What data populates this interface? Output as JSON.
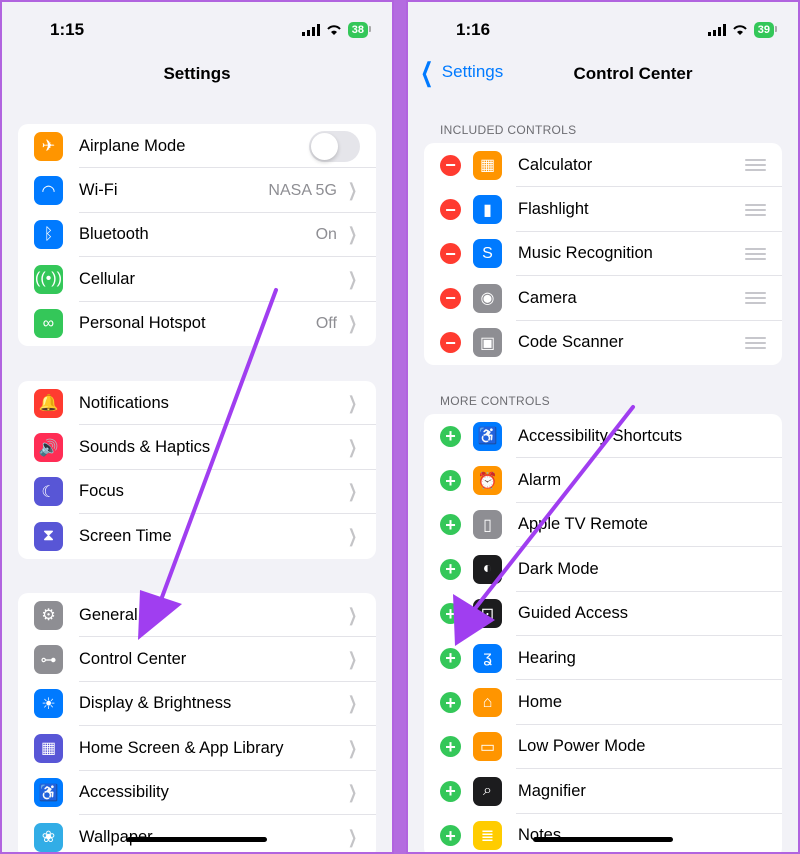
{
  "left": {
    "status": {
      "time": "1:15",
      "battery": "38"
    },
    "title": "Settings",
    "group1": [
      {
        "icon": "airplane-icon",
        "glyph": "✈",
        "color": "#ff9500",
        "label": "Airplane Mode",
        "toggle": "off"
      },
      {
        "icon": "wifi-icon",
        "glyph": "◠",
        "color": "#007aff",
        "label": "Wi-Fi",
        "value": "NASA 5G"
      },
      {
        "icon": "bluetooth-icon",
        "glyph": "ᛒ",
        "color": "#007aff",
        "label": "Bluetooth",
        "value": "On"
      },
      {
        "icon": "cellular-icon",
        "glyph": "((•))",
        "color": "#34c759",
        "label": "Cellular",
        "value": ""
      },
      {
        "icon": "hotspot-icon",
        "glyph": "∞",
        "color": "#34c759",
        "label": "Personal Hotspot",
        "value": "Off"
      }
    ],
    "group2": [
      {
        "icon": "notifications-icon",
        "glyph": "🔔",
        "color": "#ff3b30",
        "label": "Notifications"
      },
      {
        "icon": "sounds-icon",
        "glyph": "🔊",
        "color": "#ff2d55",
        "label": "Sounds & Haptics"
      },
      {
        "icon": "focus-icon",
        "glyph": "☾",
        "color": "#5856d6",
        "label": "Focus"
      },
      {
        "icon": "screen-time-icon",
        "glyph": "⧗",
        "color": "#5856d6",
        "label": "Screen Time"
      }
    ],
    "group3": [
      {
        "icon": "gear-icon",
        "glyph": "⚙",
        "color": "#8e8e93",
        "label": "General"
      },
      {
        "icon": "control-center-icon",
        "glyph": "⊶",
        "color": "#8e8e93",
        "label": "Control Center"
      },
      {
        "icon": "brightness-icon",
        "glyph": "☀",
        "color": "#007aff",
        "label": "Display & Brightness"
      },
      {
        "icon": "home-screen-icon",
        "glyph": "▦",
        "color": "#5856d6",
        "label": "Home Screen & App Library"
      },
      {
        "icon": "accessibility-icon",
        "glyph": "♿",
        "color": "#007aff",
        "label": "Accessibility"
      },
      {
        "icon": "wallpaper-icon",
        "glyph": "❀",
        "color": "#32ade6",
        "label": "Wallpaper"
      }
    ]
  },
  "right": {
    "status": {
      "time": "1:16",
      "battery": "39"
    },
    "back_label": "Settings",
    "title": "Control Center",
    "included_header": "INCLUDED CONTROLS",
    "included": [
      {
        "icon": "calculator-icon",
        "glyph": "▦",
        "color": "#ff9500",
        "label": "Calculator"
      },
      {
        "icon": "flashlight-icon",
        "glyph": "▮",
        "color": "#007aff",
        "label": "Flashlight"
      },
      {
        "icon": "shazam-icon",
        "glyph": "S",
        "color": "#007aff",
        "label": "Music Recognition"
      },
      {
        "icon": "camera-icon",
        "glyph": "◉",
        "color": "#8e8e93",
        "label": "Camera"
      },
      {
        "icon": "qr-code-icon",
        "glyph": "▣",
        "color": "#8e8e93",
        "label": "Code Scanner"
      }
    ],
    "more_header": "MORE CONTROLS",
    "more": [
      {
        "icon": "accessibility-icon",
        "glyph": "♿",
        "color": "#007aff",
        "label": "Accessibility Shortcuts"
      },
      {
        "icon": "alarm-icon",
        "glyph": "⏰",
        "color": "#ff9500",
        "label": "Alarm"
      },
      {
        "icon": "remote-icon",
        "glyph": "▯",
        "color": "#8e8e93",
        "label": "Apple TV Remote"
      },
      {
        "icon": "dark-mode-icon",
        "glyph": "◐",
        "color": "#1c1c1e",
        "label": "Dark Mode"
      },
      {
        "icon": "lock-icon",
        "glyph": "⊡",
        "color": "#1c1c1e",
        "label": "Guided Access"
      },
      {
        "icon": "ear-icon",
        "glyph": "ʓ",
        "color": "#007aff",
        "label": "Hearing"
      },
      {
        "icon": "home-icon",
        "glyph": "⌂",
        "color": "#ff9500",
        "label": "Home"
      },
      {
        "icon": "battery-icon",
        "glyph": "▭",
        "color": "#ff9500",
        "label": "Low Power Mode"
      },
      {
        "icon": "magnifier-icon",
        "glyph": "⌕",
        "color": "#1c1c1e",
        "label": "Magnifier"
      },
      {
        "icon": "notes-icon",
        "glyph": "≣",
        "color": "#ffcc00",
        "label": "Notes"
      }
    ]
  },
  "accent": "#a03ef0"
}
